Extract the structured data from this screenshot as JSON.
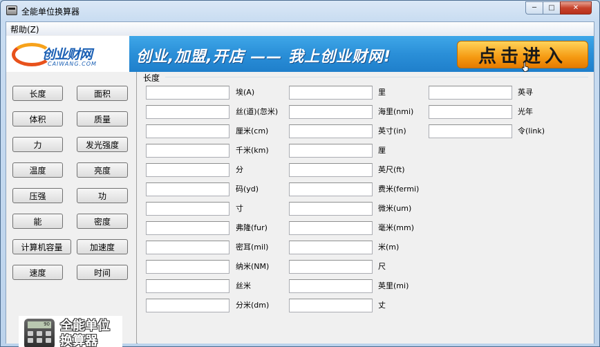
{
  "window": {
    "title": "全能单位换算器",
    "min_glyph": "─",
    "max_glyph": "□",
    "close_glyph": "✕"
  },
  "menu": {
    "help": "帮助(Z)"
  },
  "banner": {
    "logo_text": "创业财网",
    "logo_sub": "CAIWANG.COM",
    "slogan": "创业,加盟,开店 —— 我上创业财网!",
    "cta": "点击进入"
  },
  "categories": [
    "长度",
    "面积",
    "体积",
    "质量",
    "力",
    "发光强度",
    "温度",
    "亮度",
    "压强",
    "功",
    "能",
    "密度",
    "计算机容量",
    "加速度",
    "速度",
    "时间"
  ],
  "brand": {
    "line1": "全能单位",
    "line2": "换算器",
    "screen": "90"
  },
  "group": {
    "title": "长度"
  },
  "units": {
    "col1": [
      "埃(A)",
      "丝(道)(忽米)",
      "厘米(cm)",
      "千米(km)",
      "分",
      "码(yd)",
      "寸",
      "弗隆(fur)",
      "密耳(mil)",
      "纳米(NM)",
      "丝米",
      "分米(dm)"
    ],
    "col2": [
      "里",
      "海里(nmi)",
      "英寸(in)",
      "厘",
      "英尺(ft)",
      "费米(fermi)",
      "微米(um)",
      "毫米(mm)",
      "米(m)",
      "尺",
      "英里(mi)",
      "丈"
    ],
    "col3": [
      "英寻",
      "光年",
      "令(link)"
    ]
  },
  "colors": {
    "banner_blue": "#2a8fd8",
    "cta_orange": "#f59a12",
    "close_red": "#c7432c"
  }
}
